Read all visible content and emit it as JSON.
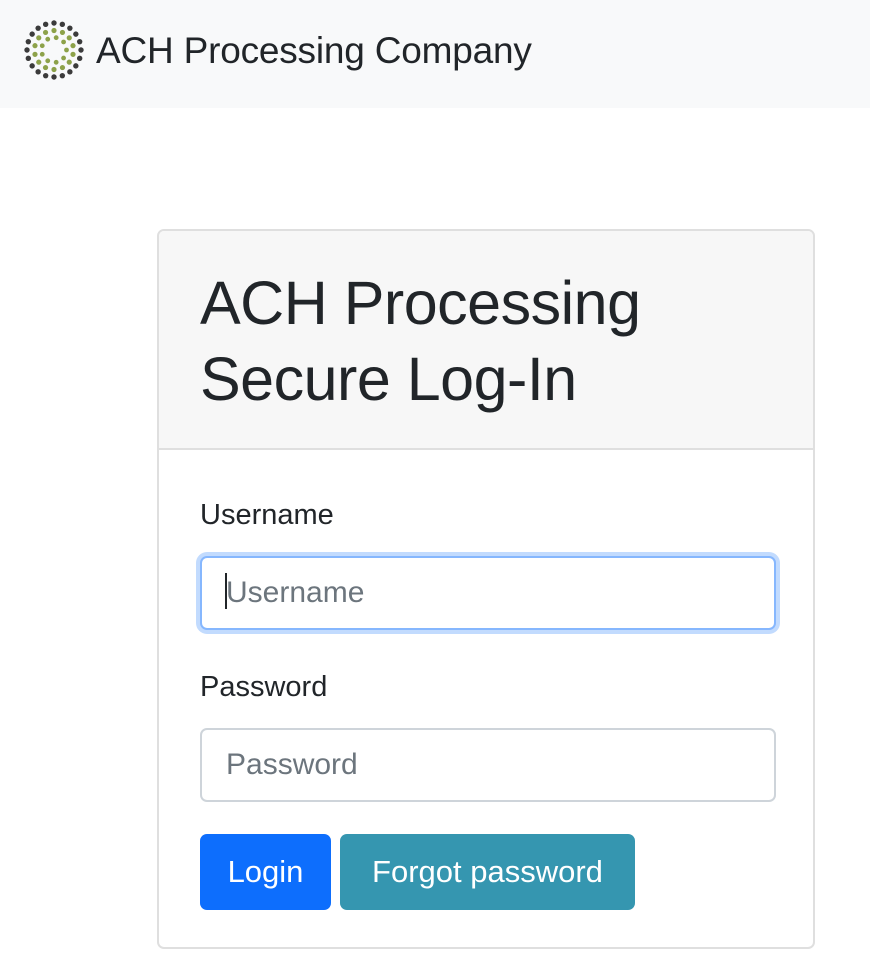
{
  "navbar": {
    "brand_text": "ACH Processing Company",
    "logo_icon": "dotted-ring-logo",
    "logo_colors": [
      "#8da24a",
      "#3b3b3b"
    ]
  },
  "login_card": {
    "title": "ACH Processing Secure Log-In",
    "username_label": "Username",
    "username_placeholder": "Username",
    "username_value": "",
    "password_label": "Password",
    "password_placeholder": "Password",
    "password_value": "",
    "login_button": "Login",
    "forgot_button": "Forgot password"
  },
  "colors": {
    "primary": "#0d6efd",
    "info": "#3596b0",
    "navbar_bg": "#f8f9fa",
    "card_header_bg": "#f7f7f7",
    "focus_ring": "#86b7fe"
  }
}
